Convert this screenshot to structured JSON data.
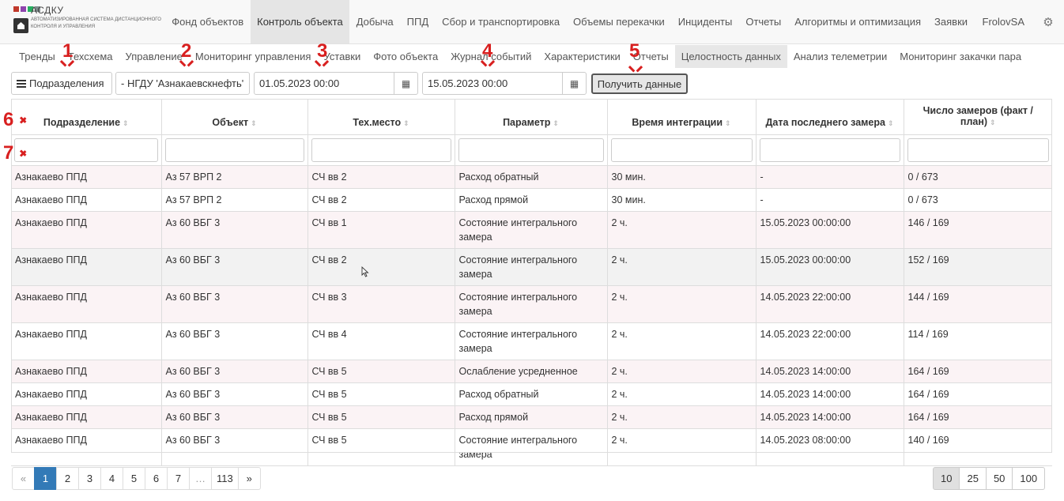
{
  "app": {
    "logo_title": "АСДКУ",
    "logo_subtitle": "Автоматизированная система дистанционного контроля и управления",
    "logo_colors": [
      "#c0392b",
      "#8e44ad",
      "#27ae60",
      "#7f8c8d"
    ],
    "user": "FrolovSA"
  },
  "nav": [
    {
      "label": "Фонд объектов",
      "active": false
    },
    {
      "label": "Контроль объекта",
      "active": true
    },
    {
      "label": "Добыча",
      "active": false
    },
    {
      "label": "ППД",
      "active": false
    },
    {
      "label": "Сбор и транспортировка",
      "active": false
    },
    {
      "label": "Объемы перекачки",
      "active": false
    },
    {
      "label": "Инциденты",
      "active": false
    },
    {
      "label": "Отчеты",
      "active": false
    },
    {
      "label": "Алгоритмы и оптимизация",
      "active": false
    },
    {
      "label": "Заявки",
      "active": false
    }
  ],
  "subnav": [
    {
      "label": "Тренды",
      "active": false
    },
    {
      "label": "Техсхема",
      "active": false
    },
    {
      "label": "Управление",
      "active": false
    },
    {
      "label": "Мониторинг управления",
      "active": false
    },
    {
      "label": "Уставки",
      "active": false
    },
    {
      "label": "Фото объекта",
      "active": false
    },
    {
      "label": "Журнал событий",
      "active": false
    },
    {
      "label": "Характеристики",
      "active": false
    },
    {
      "label": "Отчеты",
      "active": false
    },
    {
      "label": "Целостность данных",
      "active": true
    },
    {
      "label": "Анализ телеметрии",
      "active": false
    },
    {
      "label": "Мониторинг закачки пара",
      "active": false
    }
  ],
  "toolbar": {
    "departments_label": "Подразделения",
    "org_label": "- НГДУ 'Азнакаевскнефть'",
    "date_from": "01.05.2023 00:00",
    "date_to": "15.05.2023 00:00",
    "get_data_label": "Получить данные"
  },
  "table": {
    "headers": [
      "Подразделение",
      "Объект",
      "Тех.место",
      "Параметр",
      "Время интеграции",
      "Дата последнего замера",
      "Число замеров (факт / план)"
    ],
    "rows": [
      [
        "Азнакаево ППД",
        "Аз 57 ВРП 2",
        "СЧ вв 2",
        "Расход обратный",
        "30 мин.",
        "-",
        "0 / 673"
      ],
      [
        "Азнакаево ППД",
        "Аз 57 ВРП 2",
        "СЧ вв 2",
        "Расход прямой",
        "30 мин.",
        "-",
        "0 / 673"
      ],
      [
        "Азнакаево ППД",
        "Аз 60 ВБГ 3",
        "СЧ вв 1",
        "Состояние интегрального замера",
        "2 ч.",
        "15.05.2023 00:00:00",
        "146 / 169"
      ],
      [
        "Азнакаево ППД",
        "Аз 60 ВБГ 3",
        "СЧ вв 2",
        "Состояние интегрального замера",
        "2 ч.",
        "15.05.2023 00:00:00",
        "152 / 169"
      ],
      [
        "Азнакаево ППД",
        "Аз 60 ВБГ 3",
        "СЧ вв 3",
        "Состояние интегрального замера",
        "2 ч.",
        "14.05.2023 22:00:00",
        "144 / 169"
      ],
      [
        "Азнакаево ППД",
        "Аз 60 ВБГ 3",
        "СЧ вв 4",
        "Состояние интегрального замера",
        "2 ч.",
        "14.05.2023 22:00:00",
        "114 / 169"
      ],
      [
        "Азнакаево ППД",
        "Аз 60 ВБГ 3",
        "СЧ вв 5",
        "Ослабление усредненное",
        "2 ч.",
        "14.05.2023 14:00:00",
        "164 / 169"
      ],
      [
        "Азнакаево ППД",
        "Аз 60 ВБГ 3",
        "СЧ вв 5",
        "Расход обратный",
        "2 ч.",
        "14.05.2023 14:00:00",
        "164 / 169"
      ],
      [
        "Азнакаево ППД",
        "Аз 60 ВБГ 3",
        "СЧ вв 5",
        "Расход прямой",
        "2 ч.",
        "14.05.2023 14:00:00",
        "164 / 169"
      ],
      [
        "Азнакаево ППД",
        "Аз 60 ВБГ 3",
        "СЧ вв 5",
        "Состояние интегрального замера",
        "2 ч.",
        "14.05.2023 08:00:00",
        "140 / 169"
      ]
    ]
  },
  "pagination": {
    "prev": "«",
    "pages": [
      "1",
      "2",
      "3",
      "4",
      "5",
      "6",
      "7",
      "…",
      "113"
    ],
    "active": "1",
    "next": "»",
    "page_sizes": [
      "10",
      "25",
      "50",
      "100"
    ],
    "active_size": "10"
  },
  "annotations": [
    "1",
    "2",
    "3",
    "4",
    "5",
    "6",
    "7"
  ]
}
